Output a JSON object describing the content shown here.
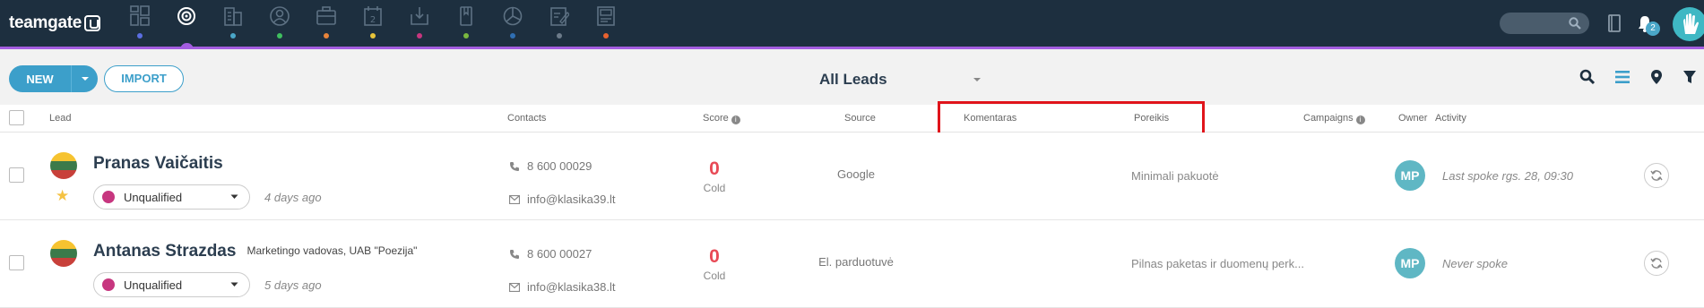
{
  "app": {
    "logo_text": "teamgate"
  },
  "nav": {
    "items": [
      {
        "icon": "dashboard-icon",
        "dot": "#5b6ee1"
      },
      {
        "icon": "leads-target-icon",
        "dot": "#a35de0",
        "active": true
      },
      {
        "icon": "companies-icon",
        "dot": "#4aa7c9"
      },
      {
        "icon": "contacts-icon",
        "dot": "#3fbf5f"
      },
      {
        "icon": "deals-briefcase-icon",
        "dot": "#e8843a"
      },
      {
        "icon": "calendar-icon",
        "dot": "#e8c43a"
      },
      {
        "icon": "inbox-icon",
        "dot": "#c7367f"
      },
      {
        "icon": "documents-icon",
        "dot": "#7ab83f"
      },
      {
        "icon": "reports-icon",
        "dot": "#2f6fb3"
      },
      {
        "icon": "notes-icon",
        "dot": "#6c7b8a"
      },
      {
        "icon": "invoices-icon",
        "dot": "#e8622f"
      }
    ],
    "notification_count": "2"
  },
  "toolbar": {
    "new_label": "NEW",
    "import_label": "IMPORT",
    "view_title": "All Leads"
  },
  "table": {
    "headers": {
      "lead": "Lead",
      "contacts": "Contacts",
      "score": "Score",
      "source": "Source",
      "komentaras": "Komentaras",
      "poreikis": "Poreikis",
      "campaigns": "Campaigns",
      "owner": "Owner",
      "activity": "Activity"
    },
    "rows": [
      {
        "name": "Pranas Vaičaitis",
        "title": "",
        "status": "Unqualified",
        "created": "4 days ago",
        "phone": "8 600 00029",
        "email": "info@klasika39.lt",
        "score": "0",
        "score_label": "Cold",
        "source": "Google",
        "komentaras": "",
        "poreikis": "Minimali pakuotė",
        "owner_initials": "MP",
        "activity": "Last spoke rgs. 28, 09:30",
        "starred": true
      },
      {
        "name": "Antanas Strazdas",
        "title": "Marketingo vadovas, UAB \"Poezija\"",
        "status": "Unqualified",
        "created": "5 days ago",
        "phone": "8 600 00027",
        "email": "info@klasika38.lt",
        "score": "0",
        "score_label": "Cold",
        "source": "El. parduotuvė",
        "komentaras": "",
        "poreikis": "Pilnas paketas ir duomenų perk...",
        "owner_initials": "MP",
        "activity": "Never spoke",
        "starred": false
      }
    ]
  },
  "colors": {
    "topbar": "#1d2f3f",
    "accent": "#a35de0",
    "primary_button": "#3c9fca",
    "score": "#e84a56",
    "status_dot": "#c7367f",
    "highlight": "#e0141b"
  }
}
